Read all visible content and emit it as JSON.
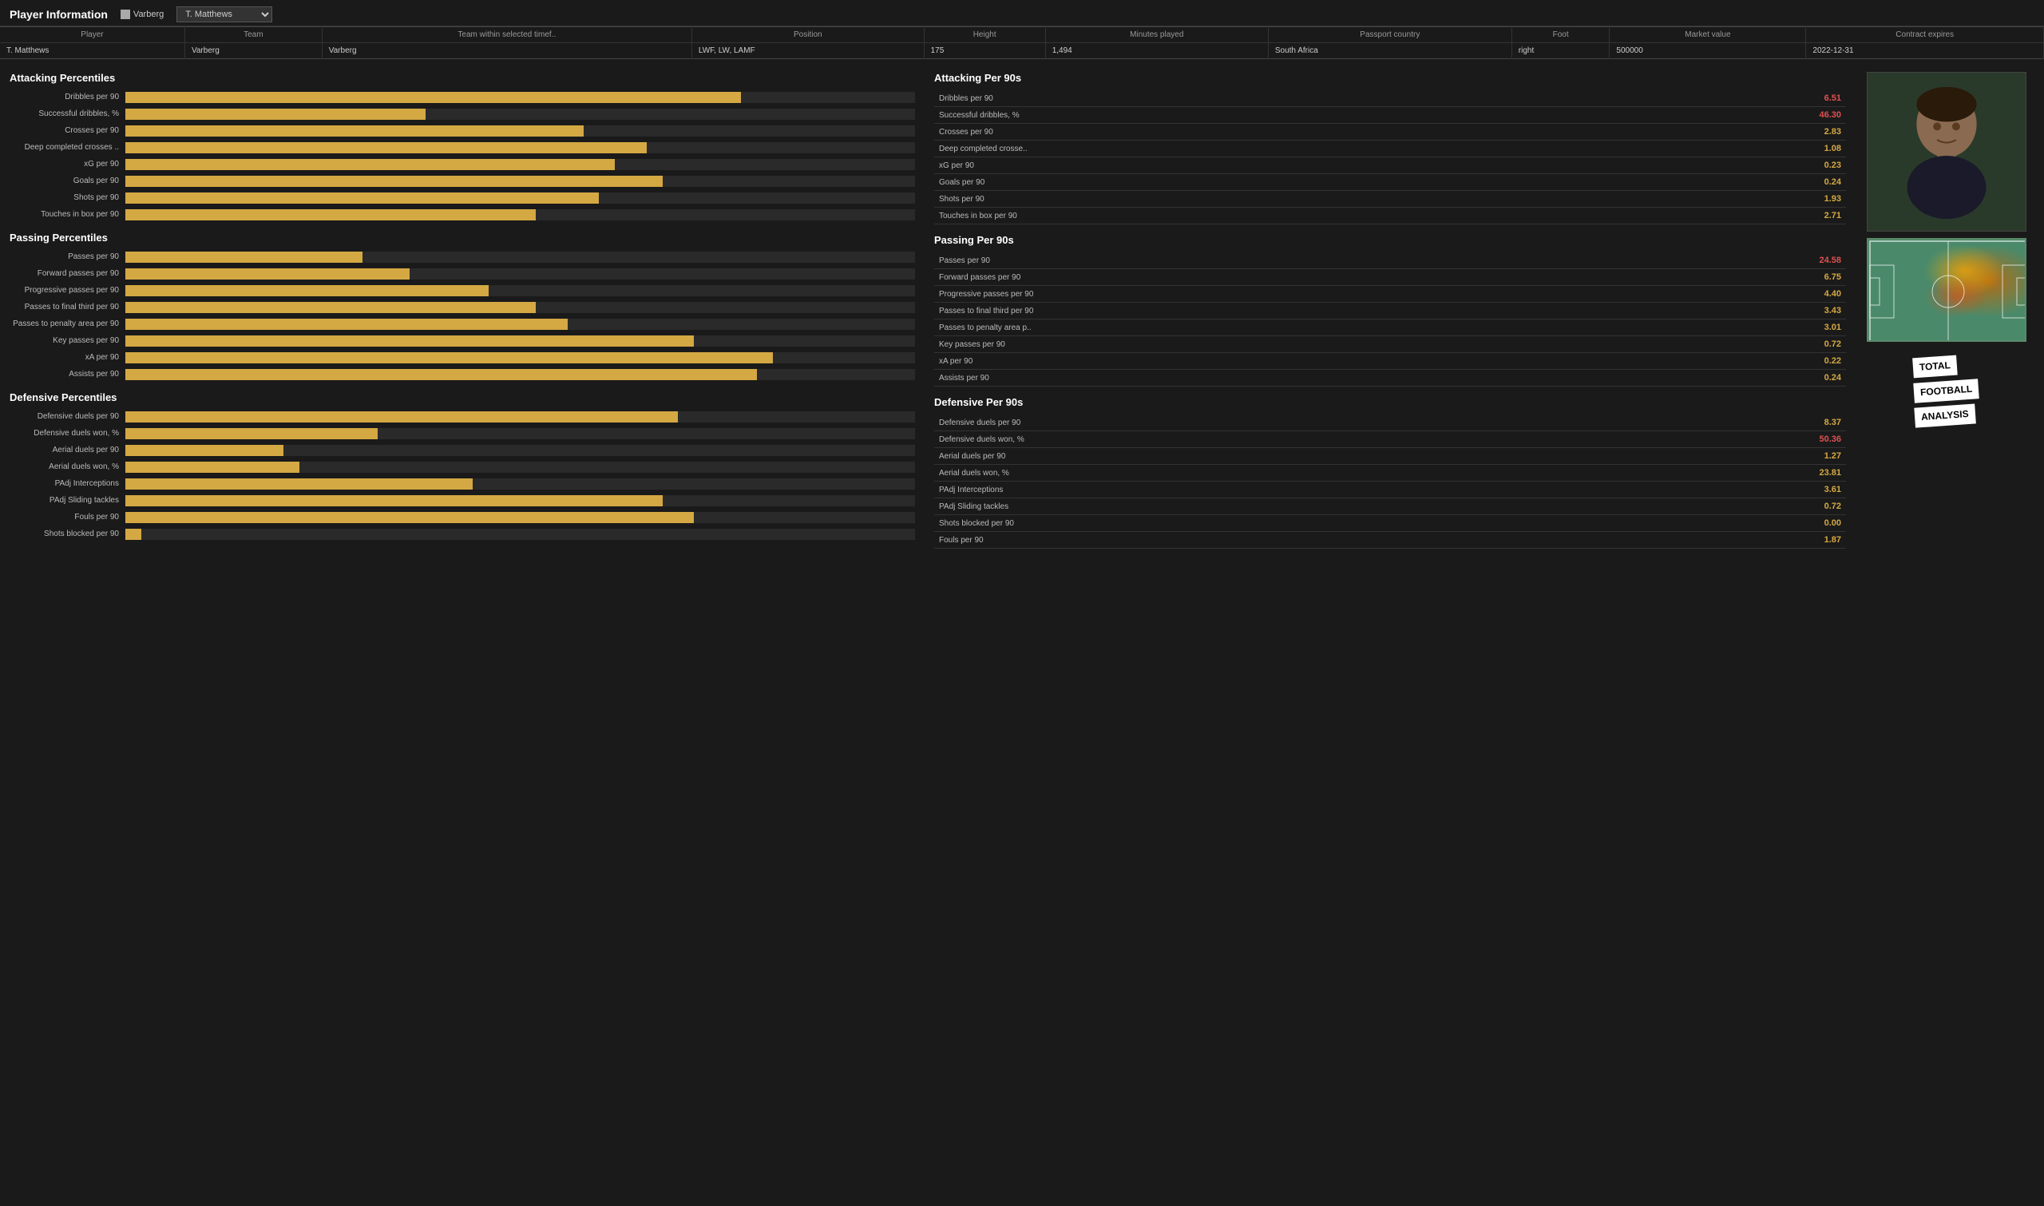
{
  "header": {
    "title": "Player Information",
    "team": "Varberg",
    "player_dropdown": "T. Matthews"
  },
  "player_info": {
    "columns": [
      "Player",
      "Team",
      "Team within selected timef..",
      "Position",
      "Height",
      "Minutes played",
      "Passport country",
      "Foot",
      "Market value",
      "Contract expires"
    ],
    "row": [
      "T. Matthews",
      "Varberg",
      "Varberg",
      "LWF, LW, LAMF",
      "175",
      "1,494",
      "South Africa",
      "right",
      "500000",
      "2022-12-31"
    ]
  },
  "attacking_percentiles_title": "Attacking Percentiles",
  "attacking_bars": [
    {
      "label": "Dribbles per 90",
      "pct": 78
    },
    {
      "label": "Successful dribbles, %",
      "pct": 38
    },
    {
      "label": "Crosses per 90",
      "pct": 58
    },
    {
      "label": "Deep completed crosses ..",
      "pct": 66
    },
    {
      "label": "xG per 90",
      "pct": 62
    },
    {
      "label": "Goals per 90",
      "pct": 68
    },
    {
      "label": "Shots per 90",
      "pct": 60
    },
    {
      "label": "Touches in box per 90",
      "pct": 52
    }
  ],
  "passing_percentiles_title": "Passing Percentiles",
  "passing_bars": [
    {
      "label": "Passes per 90",
      "pct": 30
    },
    {
      "label": "Forward passes per 90",
      "pct": 36
    },
    {
      "label": "Progressive passes per 90",
      "pct": 46
    },
    {
      "label": "Passes to final third per 90",
      "pct": 52
    },
    {
      "label": "Passes to penalty area per 90",
      "pct": 56
    },
    {
      "label": "Key passes per 90",
      "pct": 72
    },
    {
      "label": "xA per 90",
      "pct": 82
    },
    {
      "label": "Assists per 90",
      "pct": 80
    }
  ],
  "defensive_percentiles_title": "Defensive Percentiles",
  "defensive_bars": [
    {
      "label": "Defensive duels per 90",
      "pct": 70
    },
    {
      "label": "Defensive duels won, %",
      "pct": 32
    },
    {
      "label": "Aerial duels per 90",
      "pct": 20
    },
    {
      "label": "Aerial duels won, %",
      "pct": 22
    },
    {
      "label": "PAdj Interceptions",
      "pct": 44
    },
    {
      "label": "PAdj Sliding tackles",
      "pct": 68
    },
    {
      "label": "Fouls per 90",
      "pct": 72
    },
    {
      "label": "Shots blocked per 90",
      "pct": 2
    }
  ],
  "attacking_per90_title": "Attacking Per 90s",
  "attacking_stats": [
    {
      "name": "Dribbles per 90",
      "value": "6.51",
      "highlight": true
    },
    {
      "name": "Successful dribbles, %",
      "value": "46.30",
      "highlight": true
    },
    {
      "name": "Crosses per 90",
      "value": "2.83",
      "highlight": false
    },
    {
      "name": "Deep completed crosse..",
      "value": "1.08",
      "highlight": false
    },
    {
      "name": "xG per 90",
      "value": "0.23",
      "highlight": false
    },
    {
      "name": "Goals per 90",
      "value": "0.24",
      "highlight": false
    },
    {
      "name": "Shots per 90",
      "value": "1.93",
      "highlight": false
    },
    {
      "name": "Touches in box per 90",
      "value": "2.71",
      "highlight": false
    }
  ],
  "passing_per90_title": "Passing Per 90s",
  "passing_stats": [
    {
      "name": "Passes per 90",
      "value": "24.58",
      "highlight": true
    },
    {
      "name": "Forward passes per 90",
      "value": "6.75",
      "highlight": false
    },
    {
      "name": "Progressive passes per 90",
      "value": "4.40",
      "highlight": false
    },
    {
      "name": "Passes to final third per 90",
      "value": "3.43",
      "highlight": false
    },
    {
      "name": "Passes to penalty area p..",
      "value": "3.01",
      "highlight": false
    },
    {
      "name": "Key passes per 90",
      "value": "0.72",
      "highlight": false
    },
    {
      "name": "xA per 90",
      "value": "0.22",
      "highlight": false
    },
    {
      "name": "Assists per 90",
      "value": "0.24",
      "highlight": false
    }
  ],
  "defensive_per90_title": "Defensive Per 90s",
  "defensive_stats": [
    {
      "name": "Defensive duels per 90",
      "value": "8.37",
      "highlight": false
    },
    {
      "name": "Defensive duels won, %",
      "value": "50.36",
      "highlight": true
    },
    {
      "name": "Aerial duels per 90",
      "value": "1.27",
      "highlight": false
    },
    {
      "name": "Aerial duels won, %",
      "value": "23.81",
      "highlight": false
    },
    {
      "name": "PAdj Interceptions",
      "value": "3.61",
      "highlight": false
    },
    {
      "name": "PAdj Sliding tackles",
      "value": "0.72",
      "highlight": false
    },
    {
      "name": "Shots blocked per 90",
      "value": "0.00",
      "highlight": false
    },
    {
      "name": "Fouls per 90",
      "value": "1.87",
      "highlight": false
    }
  ]
}
